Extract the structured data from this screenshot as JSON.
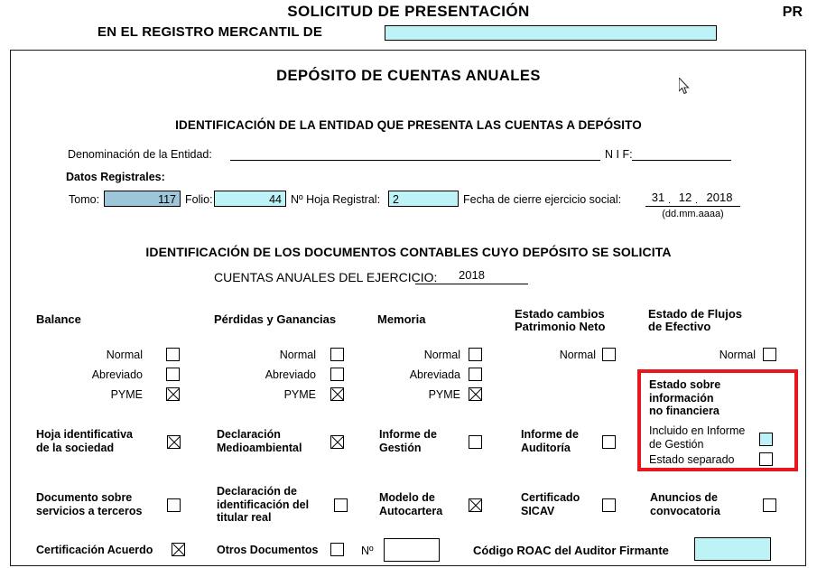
{
  "header": {
    "title": "SOLICITUD DE PRESENTACIÓN",
    "subtitle": "EN EL REGISTRO MERCANTIL DE",
    "registry_value": "",
    "code": "PR"
  },
  "form": {
    "deposit_title": "DEPÓSITO DE CUENTAS ANUALES",
    "entity_section_title": "IDENTIFICACIÓN DE LA ENTIDAD QUE PRESENTA LAS CUENTAS A DEPÓSITO",
    "entity": {
      "name_label": "Denominación de la Entidad:",
      "name_value": "",
      "nif_label": "N I F:",
      "nif_value": ""
    },
    "registry_data": {
      "heading": "Datos Registrales:",
      "tomo_label": "Tomo:",
      "tomo_value": "117",
      "folio_label": "Folio:",
      "folio_value": "44",
      "hoja_label": "Nº Hoja Registral:",
      "hoja_value": "2",
      "fecha_label": "Fecha de cierre ejercicio social:",
      "fecha_dd": "31",
      "fecha_sep1": ".",
      "fecha_mm": "12",
      "fecha_sep2": ".",
      "fecha_yyyy": "2018",
      "fecha_format": "(dd.mm.aaaa)"
    },
    "docs_section_title": "IDENTIFICACIÓN DE LOS DOCUMENTOS CONTABLES CUYO DEPÓSITO SE SOLICITA",
    "ejercicio": {
      "label": "CUENTAS ANUALES DEL EJERCICIO:",
      "value": "2018"
    }
  },
  "columns": [
    {
      "heading": "Balance",
      "options": [
        {
          "label": "Normal",
          "checked": false
        },
        {
          "label": "Abreviado",
          "checked": false
        },
        {
          "label": "PYME",
          "checked": true
        }
      ]
    },
    {
      "heading": "Pérdidas y Ganancias",
      "options": [
        {
          "label": "Normal",
          "checked": false
        },
        {
          "label": "Abreviado",
          "checked": false
        },
        {
          "label": "PYME",
          "checked": true
        }
      ]
    },
    {
      "heading": "Memoria",
      "options": [
        {
          "label": "Normal",
          "checked": false
        },
        {
          "label": "Abreviada",
          "checked": false
        },
        {
          "label": "PYME",
          "checked": true
        }
      ]
    },
    {
      "heading": "Estado cambios\nPatrimonio Neto",
      "heading_line1": "Estado cambios",
      "heading_line2": "Patrimonio Neto",
      "options": [
        {
          "label": "Normal",
          "checked": false
        }
      ]
    },
    {
      "heading_line1": "Estado de Flujos",
      "heading_line2": "de Efectivo",
      "options": [
        {
          "label": "Normal",
          "checked": false
        }
      ]
    }
  ],
  "non_financial_box": {
    "title": "Estado sobre información no financiera",
    "title_line1": "Estado sobre",
    "title_line2": "información",
    "title_line3": "no financiera",
    "option1_line1": "Incluido en Informe",
    "option1_line2": "de Gestión",
    "option1_checked": false,
    "option1_filled": true,
    "option2": "Estado separado",
    "option2_checked": false,
    "border_color": "#e8161d"
  },
  "doc_rows": [
    {
      "items": [
        {
          "line1": "Hoja identificativa",
          "line2": "de la sociedad",
          "checked": true
        },
        {
          "line1": "Declaración",
          "line2": "Medioambiental",
          "checked": true
        },
        {
          "line1": "Informe de",
          "line2": "Gestión",
          "checked": false
        },
        {
          "line1": "Informe de",
          "line2": "Auditoría",
          "checked": false
        }
      ]
    },
    {
      "items": [
        {
          "line1": "Documento sobre",
          "line2": "servicios a terceros",
          "checked": false
        },
        {
          "line1": "Declaración de",
          "line2": "identificación del",
          "line3": "titular real",
          "checked": false
        },
        {
          "line1": "Modelo de",
          "line2": "Autocartera",
          "checked": true
        },
        {
          "line1": "Certificado",
          "line2": "SICAV",
          "checked": false
        },
        {
          "line1": "Anuncios de",
          "line2": "convocatoria",
          "checked": false
        }
      ]
    }
  ],
  "bottom_row": {
    "cert_label": "Certificación Acuerdo",
    "cert_checked": true,
    "otros_label": "Otros Documentos",
    "otros_checked": false,
    "num_label": "Nº",
    "num_value": "",
    "roac_label": "Código ROAC del Auditor Firmante",
    "roac_value": ""
  },
  "colors": {
    "input_cyan": "#bdf2f7",
    "input_selected": "#9dc6d8",
    "alert_red": "#e8161d"
  }
}
